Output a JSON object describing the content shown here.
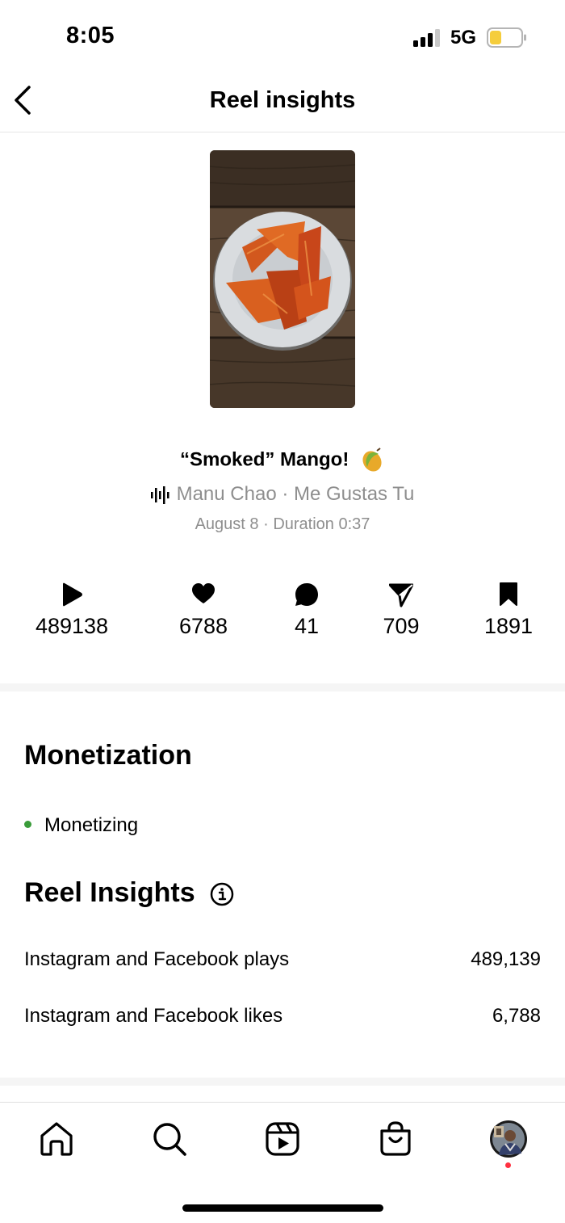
{
  "status_bar": {
    "time": "8:05",
    "network": "5G",
    "icons": [
      "signal-icon",
      "battery-icon"
    ],
    "battery_color": "#f5cd3c"
  },
  "header": {
    "title": "Reel insights",
    "back_icon": "chevron-left-icon"
  },
  "reel": {
    "title": "“Smoked” Mango!",
    "title_emoji_icon": "mango-icon",
    "audio": "Manu Chao · Me Gustas Tu",
    "audio_icon": "audio-wave-icon",
    "meta": "August 8 · Duration 0:37"
  },
  "stats": [
    {
      "icon": "play-icon",
      "value": "489138"
    },
    {
      "icon": "heart-icon",
      "value": "6788"
    },
    {
      "icon": "comment-icon",
      "value": "41"
    },
    {
      "icon": "share-icon",
      "value": "709"
    },
    {
      "icon": "bookmark-icon",
      "value": "1891"
    }
  ],
  "monetization": {
    "title": "Monetization",
    "status": "Monetizing",
    "status_color": "#3a9c3a"
  },
  "insights": {
    "title": "Reel Insights",
    "info_icon": "info-icon",
    "rows": [
      {
        "label": "Instagram and Facebook plays",
        "value": "489,139"
      },
      {
        "label": "Instagram and Facebook likes",
        "value": "6,788"
      }
    ]
  },
  "bottom_nav": {
    "items": [
      "home-icon",
      "search-icon",
      "reels-icon",
      "shop-icon",
      "profile-avatar"
    ],
    "notification_color": "#ff3040"
  }
}
